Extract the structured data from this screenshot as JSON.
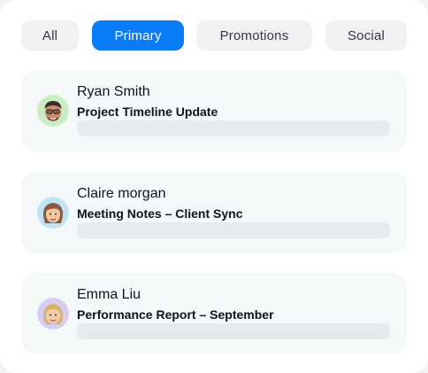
{
  "tabs": [
    {
      "label": "All",
      "active": false
    },
    {
      "label": "Primary",
      "active": true
    },
    {
      "label": "Promotions",
      "active": false
    },
    {
      "label": "Social",
      "active": false
    }
  ],
  "accent_color": "#0a7cf7",
  "emails": [
    {
      "sender": "Ryan Smith",
      "subject": "Project Timeline Update",
      "avatar": "man-memoji-icon"
    },
    {
      "sender": "Claire morgan",
      "subject": "Meeting Notes – Client Sync",
      "avatar": "woman-memoji-icon"
    },
    {
      "sender": "Emma Liu",
      "subject": "Performance Report – September",
      "avatar": "blonde-woman-memoji-icon"
    }
  ]
}
